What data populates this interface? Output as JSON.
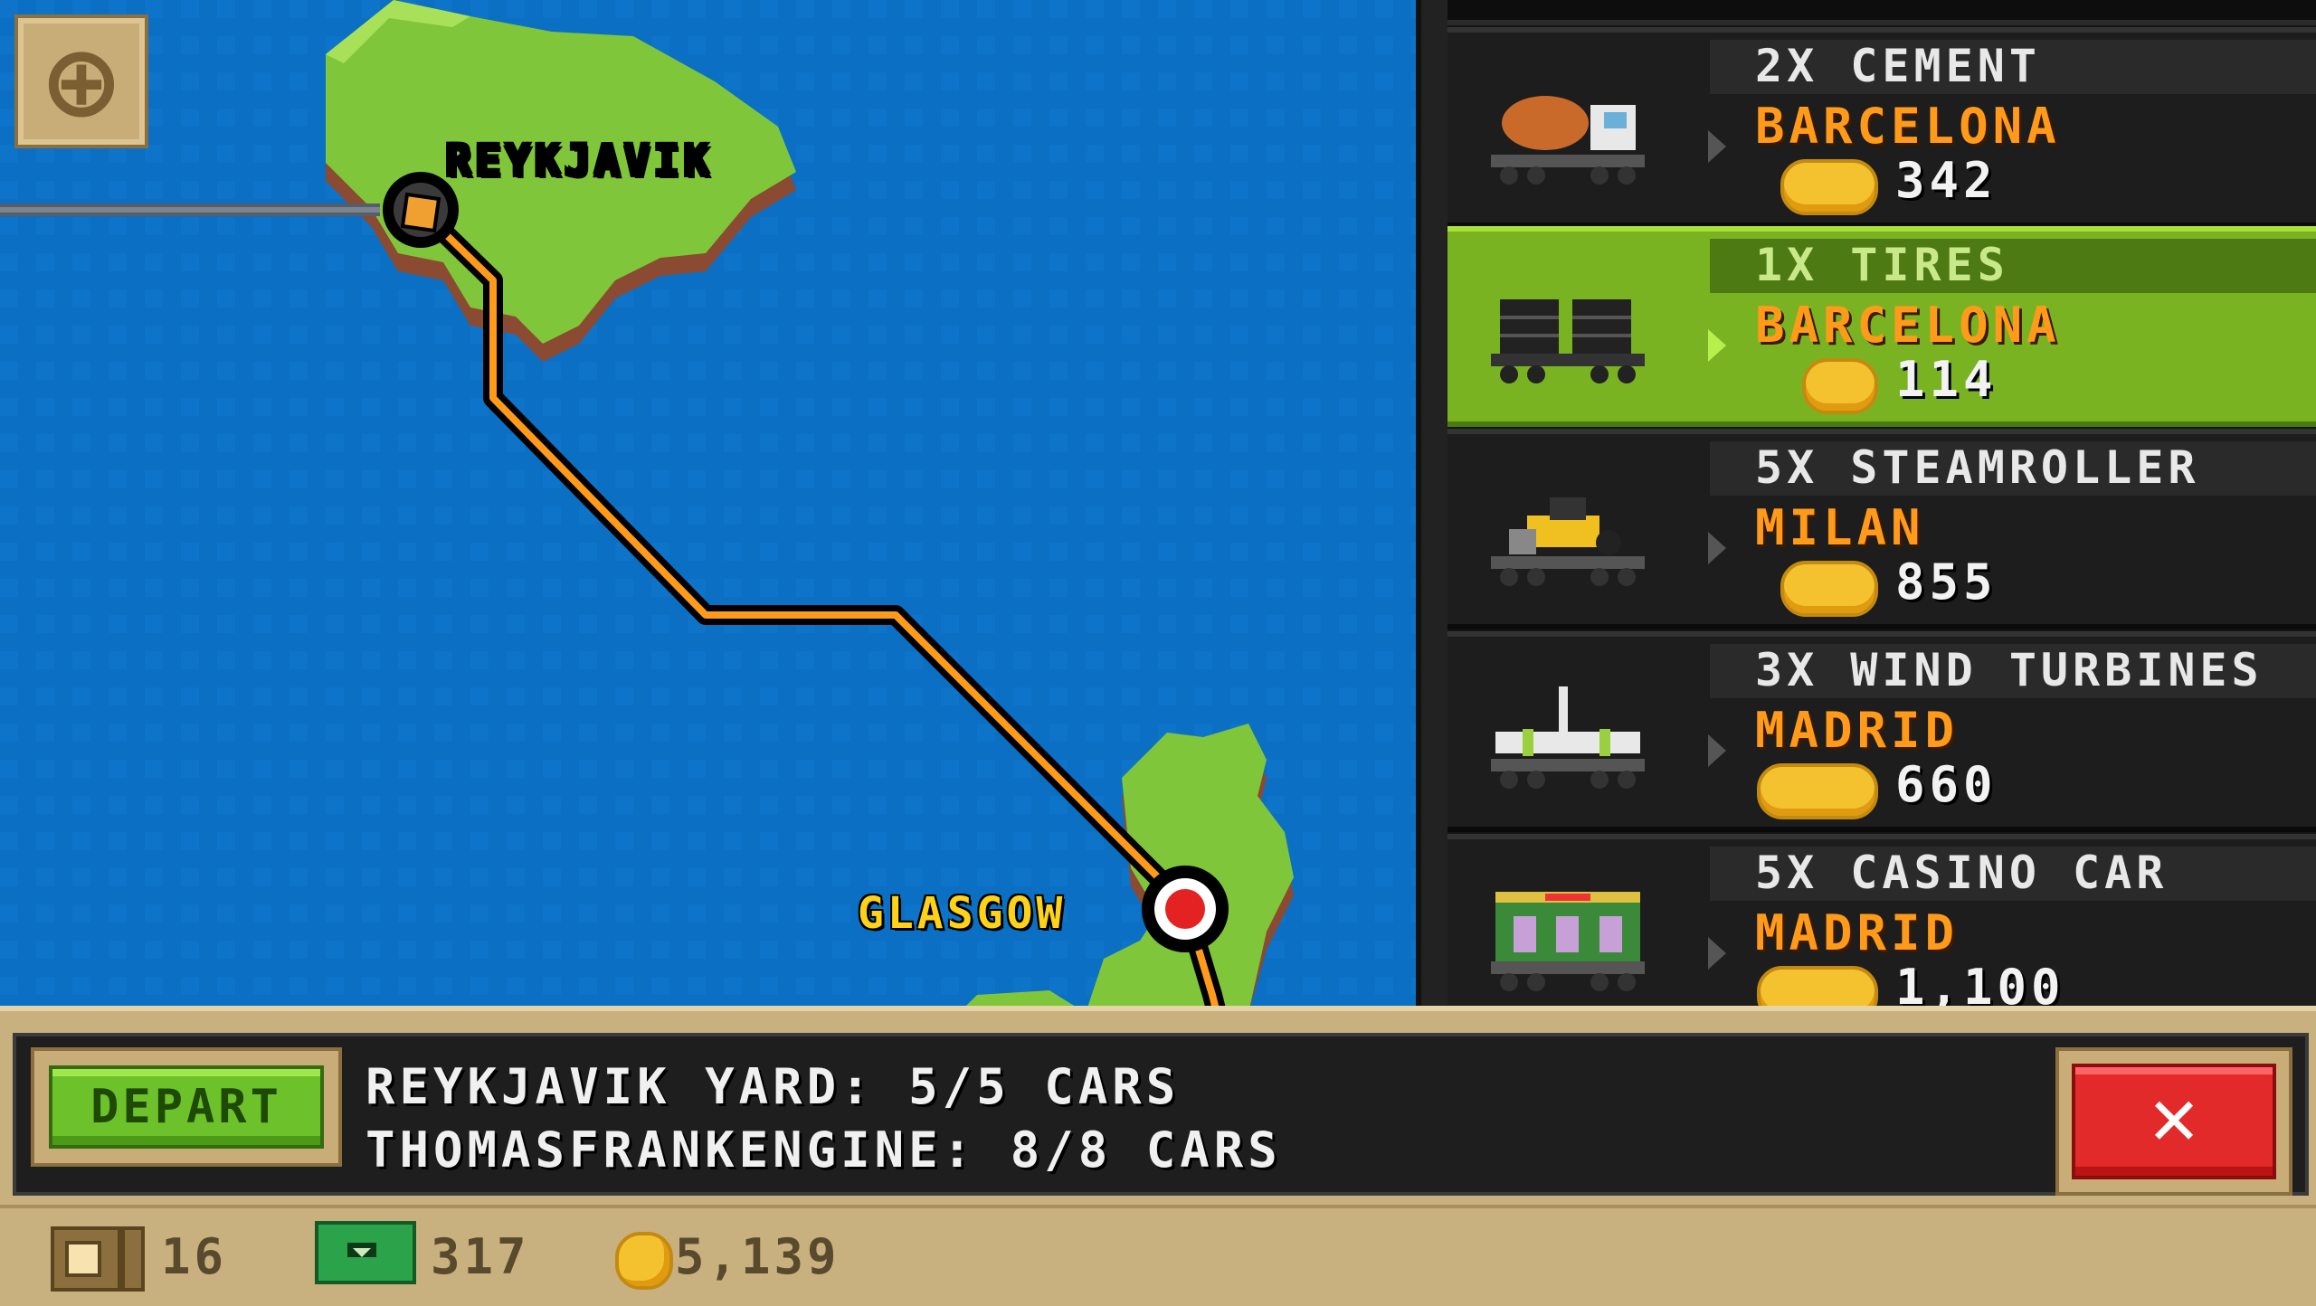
{
  "map": {
    "cities": [
      {
        "name": "REYKJAVIK",
        "color": "#ffffff"
      },
      {
        "name": "GLASGOW",
        "color": "#ffd21a"
      }
    ],
    "zoom_icon": "plus-icon"
  },
  "cargo_list": [
    {
      "title": "2X CEMENT",
      "destination": "BARCELONA",
      "price": "342",
      "icon": "cement-truck-icon",
      "selected": false
    },
    {
      "title": "1X TIRES",
      "destination": "BARCELONA",
      "price": "114",
      "icon": "tires-icon",
      "selected": true
    },
    {
      "title": "5X STEAMROLLER",
      "destination": "MILAN",
      "price": "855",
      "icon": "steamroller-icon",
      "selected": false
    },
    {
      "title": "3X WIND TURBINES",
      "destination": "MADRID",
      "price": "660",
      "icon": "wind-turbine-icon",
      "selected": false
    },
    {
      "title": "5X CASINO CAR",
      "destination": "MADRID",
      "price": "1,100",
      "icon": "casino-car-icon",
      "selected": false
    }
  ],
  "panel": {
    "depart_label": "DEPART",
    "yard_info": "REYKJAVIK YARD: 5/5 CARS",
    "engine_info": "THOMASFRANKENGINE: 8/8 CARS",
    "close_label": "✕"
  },
  "status": {
    "crates": "16",
    "cash": "317",
    "coins": "5,139"
  },
  "colors": {
    "sea": "#0a6fc2",
    "land": "#7fc63b",
    "route": "#ff9a1a",
    "selected_row": "#7ab322"
  }
}
